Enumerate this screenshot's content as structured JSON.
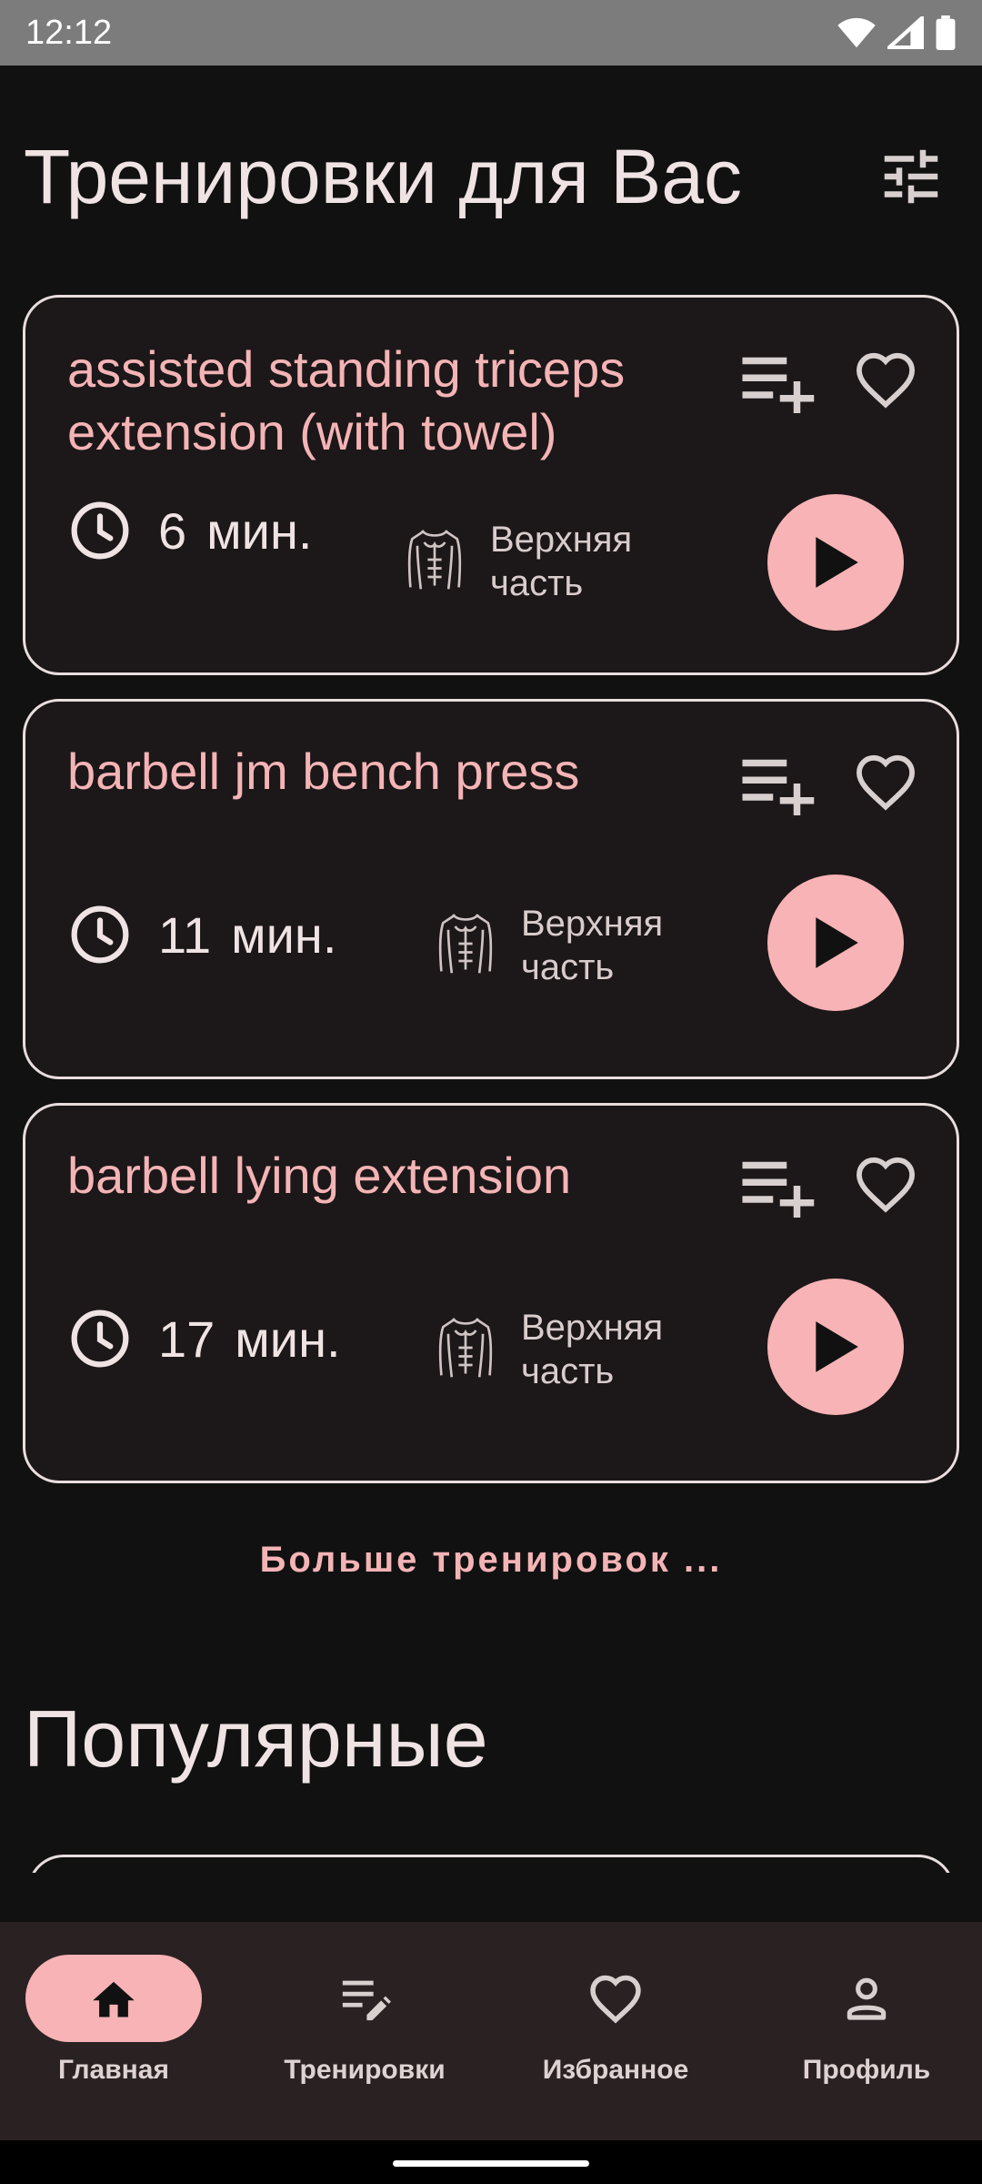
{
  "status_bar": {
    "time": "12:12",
    "icons": [
      "wifi-icon",
      "signal-icon",
      "battery-icon"
    ]
  },
  "header": {
    "title": "Тренировки для Вас",
    "filter_icon": "tune-icon"
  },
  "workouts": [
    {
      "title": "assisted standing triceps extension (with towel)",
      "duration": "6",
      "unit": "мин.",
      "body_part": "Верхняя часть"
    },
    {
      "title": "barbell jm bench press",
      "duration": "11",
      "unit": "мин.",
      "body_part": "Верхняя часть"
    },
    {
      "title": "barbell lying extension",
      "duration": "17",
      "unit": "мин.",
      "body_part": "Верхняя часть"
    }
  ],
  "more_link": "Больше тренировок ...",
  "popular": {
    "title": "Популярные"
  },
  "bottom_nav": {
    "items": [
      {
        "label": "Главная",
        "icon": "home-icon",
        "active": true
      },
      {
        "label": "Тренировки",
        "icon": "workout-list-icon",
        "active": false
      },
      {
        "label": "Избранное",
        "icon": "heart-icon",
        "active": false
      },
      {
        "label": "Профиль",
        "icon": "person-icon",
        "active": false
      }
    ]
  },
  "colors": {
    "background": "#111111",
    "card": "#1c1718",
    "accent": "#f7b3b5",
    "title_accent": "#f4b4b6",
    "text": "#efe3e3",
    "nav_bg": "#2a2122"
  }
}
